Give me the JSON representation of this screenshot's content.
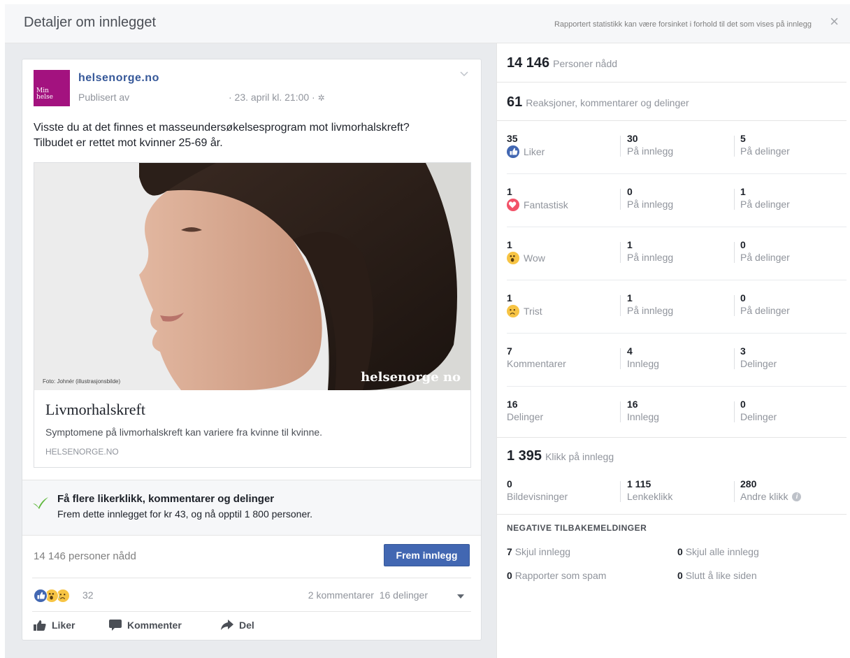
{
  "header": {
    "title": "Detaljer om innlegget",
    "note": "Rapportert statistikk kan være forsinket i forhold til det som vises på innlegg",
    "close_icon": "close-icon"
  },
  "post": {
    "avatar_text_line1": "Min",
    "avatar_text_line2": "helse",
    "page_name": "helsenorge.no",
    "published_by": "Publisert av",
    "date": "· 23. april kl. 21:00 ·",
    "text": "Visste du at det finnes et masseundersøkelsesprogram mot livmorhalskreft? Tilbudet er rettet mot kvinner 25-69 år.",
    "photo_caption": "Foto: Johnér (illustrasjonsbilde)",
    "photo_watermark": "helsenorge no",
    "link_title": "Livmorhalskreft",
    "link_description": "Symptomene på livmorhalskreft kan variere fra kvinne til kvinne.",
    "link_domain": "HELSENORGE.NO",
    "brand_color": "#a3127f"
  },
  "promo": {
    "title": "Få flere likerklikk, kommentarer og delinger",
    "text": "Frem dette innlegget for kr 43, og nå opptil 1 800 personer."
  },
  "footer": {
    "reach": "14 146 personer nådd",
    "boost_label": "Frem innlegg",
    "reaction_count": "32",
    "comments_shares": "2 kommentarer  16 delinger",
    "actions": [
      {
        "label": "Liker",
        "icon": "like-icon"
      },
      {
        "label": "Kommenter",
        "icon": "comment-icon"
      },
      {
        "label": "Del",
        "icon": "share-icon"
      }
    ]
  },
  "stats": {
    "reached": {
      "value": "14 146",
      "label": "Personer nådd"
    },
    "engagement": {
      "value": "61",
      "label": "Reaksjoner, kommentarer og delinger"
    },
    "rows": [
      {
        "c1": {
          "num": "35",
          "lbl": "Liker",
          "icon": "like"
        },
        "c2": {
          "num": "30",
          "lbl": "På innlegg"
        },
        "c3": {
          "num": "5",
          "lbl": "På delinger"
        }
      },
      {
        "c1": {
          "num": "1",
          "lbl": "Fantastisk",
          "icon": "love"
        },
        "c2": {
          "num": "0",
          "lbl": "På innlegg"
        },
        "c3": {
          "num": "1",
          "lbl": "På delinger"
        }
      },
      {
        "c1": {
          "num": "1",
          "lbl": "Wow",
          "icon": "wow"
        },
        "c2": {
          "num": "1",
          "lbl": "På innlegg"
        },
        "c3": {
          "num": "0",
          "lbl": "På delinger"
        }
      },
      {
        "c1": {
          "num": "1",
          "lbl": "Trist",
          "icon": "sad"
        },
        "c2": {
          "num": "1",
          "lbl": "På innlegg"
        },
        "c3": {
          "num": "0",
          "lbl": "På delinger"
        }
      },
      {
        "c1": {
          "num": "7",
          "lbl": "Kommentarer"
        },
        "c2": {
          "num": "4",
          "lbl": "Innlegg"
        },
        "c3": {
          "num": "3",
          "lbl": "Delinger"
        }
      },
      {
        "c1": {
          "num": "16",
          "lbl": "Delinger"
        },
        "c2": {
          "num": "16",
          "lbl": "Innlegg"
        },
        "c3": {
          "num": "0",
          "lbl": "Delinger"
        }
      }
    ],
    "clicks": {
      "value": "1 395",
      "label": "Klikk på innlegg"
    },
    "click_row": {
      "c1": {
        "num": "0",
        "lbl": "Bildevisninger"
      },
      "c2": {
        "num": "1 115",
        "lbl": "Lenkeklikk"
      },
      "c3": {
        "num": "280",
        "lbl": "Andre klikk"
      }
    },
    "negative": {
      "heading": "NEGATIVE TILBAKEMELDINGER",
      "items": [
        {
          "num": "7",
          "lbl": "Skjul innlegg"
        },
        {
          "num": "0",
          "lbl": "Skjul alle innlegg"
        },
        {
          "num": "0",
          "lbl": "Rapporter som spam"
        },
        {
          "num": "0",
          "lbl": "Slutt å like siden"
        }
      ]
    }
  }
}
